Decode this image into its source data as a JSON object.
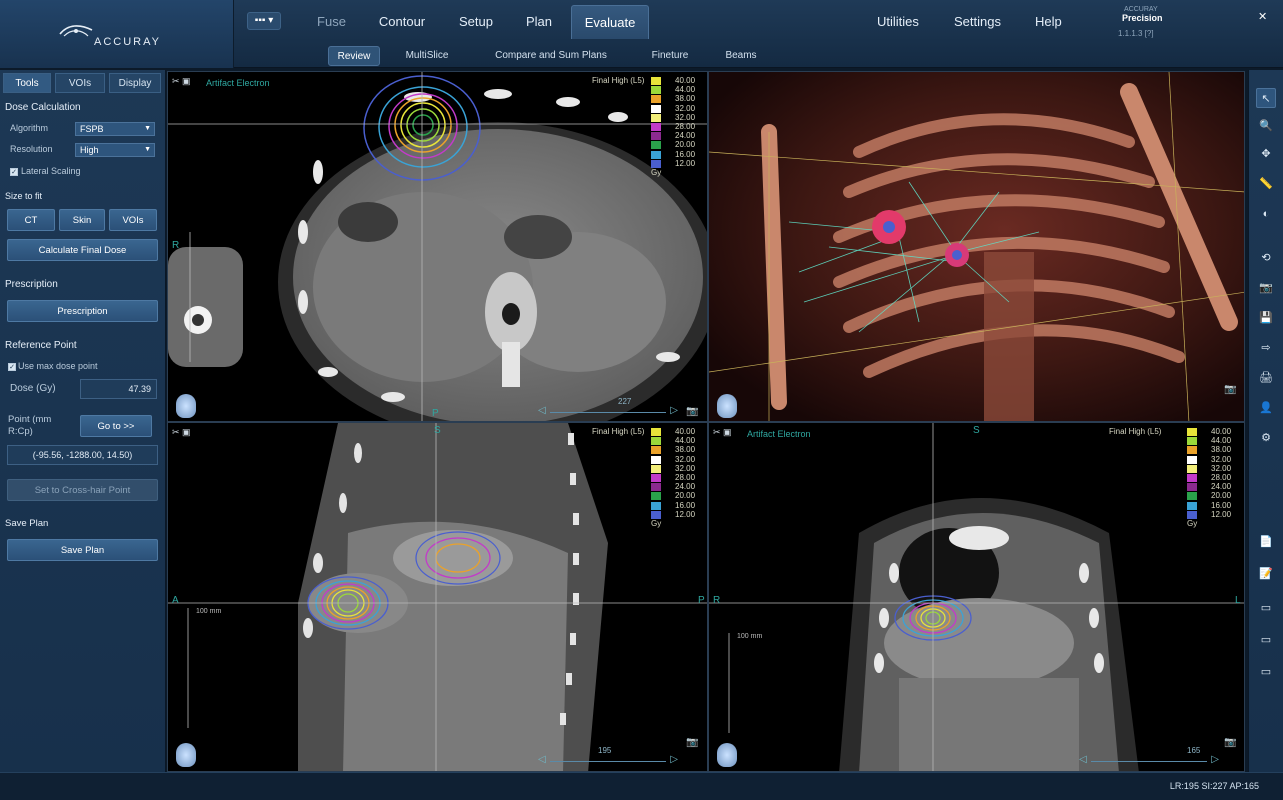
{
  "header": {
    "logo_text": "ACCURAY",
    "view_menu_label": "▪▪▪ ▾",
    "nav_tabs": [
      "Fuse",
      "Contour",
      "Setup",
      "Plan",
      "Evaluate"
    ],
    "active_tab": "Evaluate",
    "utilities": [
      "Utilities",
      "Settings",
      "Help"
    ],
    "product_small": "ACCURAY",
    "product_name": "Precision",
    "version": "1.1.1.3 [?]",
    "close_glyph": "✕",
    "subtabs": [
      "Review",
      "MultiSlice",
      "Compare and Sum Plans",
      "Fineture",
      "Beams"
    ],
    "active_subtab": "Review"
  },
  "left_panel": {
    "tabs": [
      "Tools",
      "VOIs",
      "Display"
    ],
    "active_tab": "Tools",
    "dose_calculation": {
      "title": "Dose Calculation",
      "algorithm_label": "Algorithm",
      "algorithm_value": "FSPB",
      "resolution_label": "Resolution",
      "resolution_value": "High",
      "lateral_scaling_label": "Lateral Scaling",
      "lateral_scaling_checked": true
    },
    "size_to_fit": {
      "title": "Size to fit",
      "buttons": [
        "CT",
        "Skin",
        "VOIs"
      ],
      "calc_button": "Calculate Final Dose"
    },
    "prescription": {
      "title": "Prescription",
      "button": "Prescription"
    },
    "reference_point": {
      "title": "Reference Point",
      "use_max_label": "Use max dose point",
      "use_max_checked": true,
      "dose_label": "Dose (Gy)",
      "dose_value": "47.39",
      "point_label": "Point (mm R:Cp)",
      "goto_button": "Go to >>",
      "point_value": "(-95.56, -1288.00, 14.50)",
      "crosshair_button": "Set to Cross-hair Point"
    },
    "save_plan": {
      "title": "Save Plan",
      "button": "Save Plan"
    }
  },
  "viewports": {
    "axial": {
      "label": "Artifact Electron",
      "legend_title": "Final High (L5)",
      "orient_left": "R",
      "orient_bottom": "P",
      "slider_value": "227",
      "camera_icon": "camera-icon"
    },
    "threed": {
      "camera_icon": "camera-icon"
    },
    "sagittal": {
      "label": "",
      "legend_title": "Final High (L5)",
      "orient_top": "S",
      "orient_left": "A",
      "orient_right": "P",
      "scale_label": "100 mm",
      "slider_value": "195"
    },
    "coronal": {
      "label": "Artifact Electron",
      "legend_title": "Final High (L5)",
      "orient_top": "S",
      "orient_left": "R",
      "orient_right": "L",
      "scale_label": "100 mm",
      "slider_value": "165"
    }
  },
  "dose_legend": [
    {
      "value": "40.00",
      "color": "#e7e43a"
    },
    {
      "value": "44.00",
      "color": "#9bd93a"
    },
    {
      "value": "38.00",
      "color": "#eaa22a"
    },
    {
      "value": "32.00",
      "color": "#ffffff"
    },
    {
      "value": "32.00",
      "color": "#f2ee7a"
    },
    {
      "value": "28.00",
      "color": "#c23bc9"
    },
    {
      "value": "24.00",
      "color": "#8b2a8f"
    },
    {
      "value": "20.00",
      "color": "#2aa24b"
    },
    {
      "value": "16.00",
      "color": "#3aa3d6"
    },
    {
      "value": "12.00",
      "color": "#4a5fcf"
    }
  ],
  "dose_unit": "Gy",
  "right_toolbar": {
    "tools": [
      "pointer-icon",
      "zoom-icon",
      "pan-icon",
      "measure-icon",
      "window-level-icon",
      "reset-view-icon",
      "camera-icon",
      "save-icon",
      "export-icon",
      "print-icon",
      "user-icon",
      "settings-icon",
      "document-icon",
      "note-icon",
      "page-a-icon",
      "page-b-icon",
      "page-c-icon"
    ]
  },
  "status": {
    "coordinates": "LR:195 SI:227 AP:165"
  },
  "colors": {
    "accent": "#2e557d",
    "orientation_text": "#2fa7a0"
  }
}
